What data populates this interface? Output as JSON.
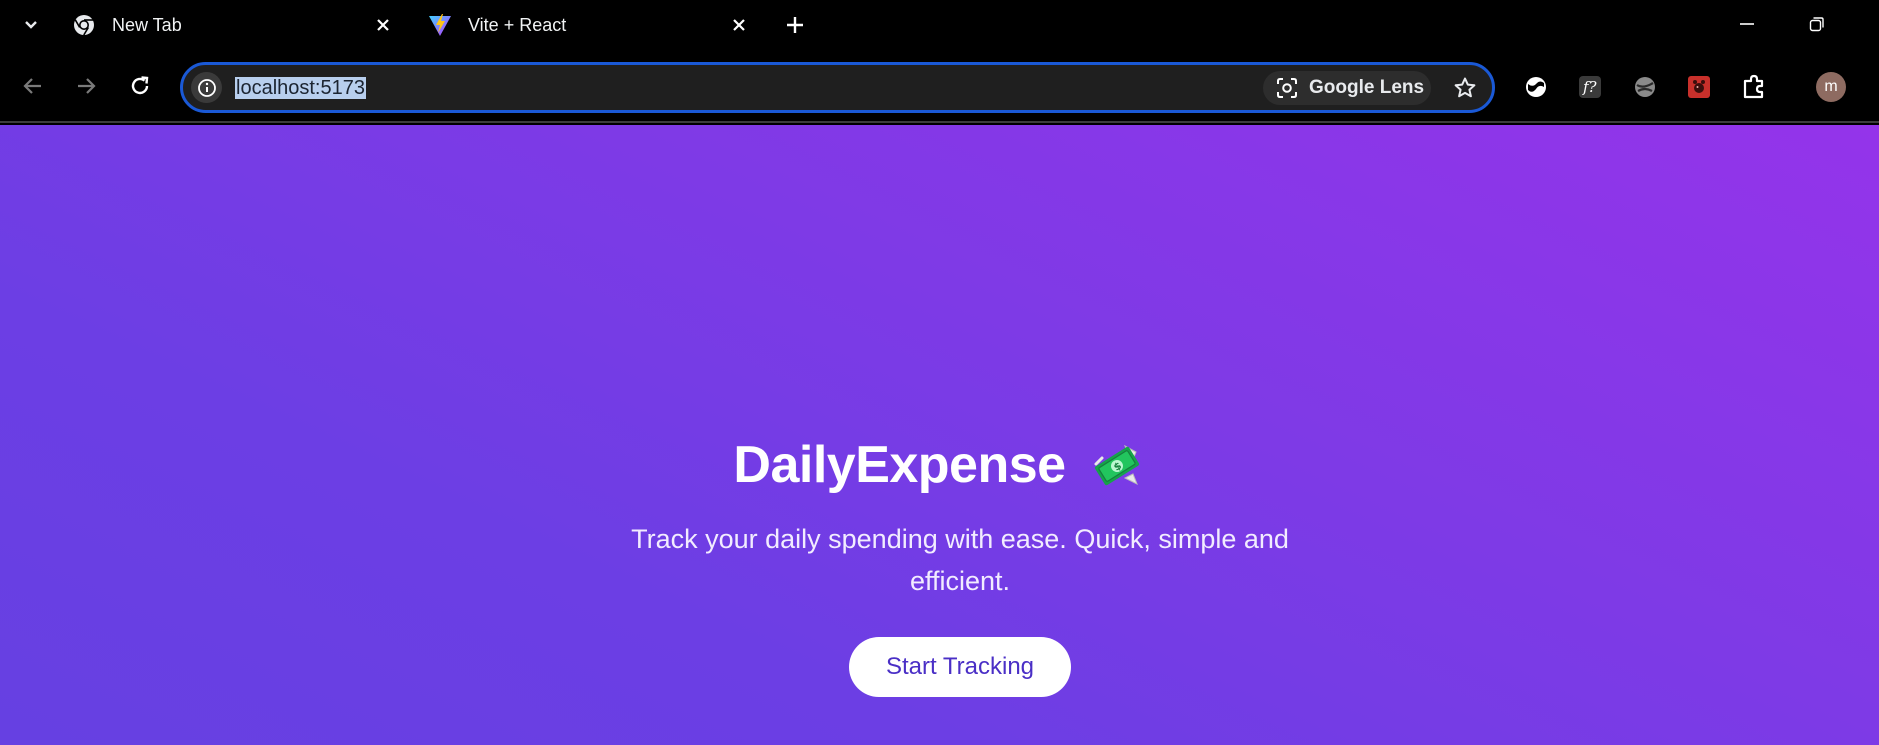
{
  "browser": {
    "tabs": [
      {
        "title": "New Tab",
        "favicon": "chrome-icon",
        "active": false
      },
      {
        "title": "Vite + React",
        "favicon": "vite-icon",
        "active": true
      }
    ],
    "address_bar": {
      "url": "localhost:5173"
    },
    "lens": {
      "label": "Google Lens"
    },
    "avatar": {
      "initial": "m",
      "color": "#8e6b61"
    },
    "extensions": [
      "world-icon",
      "font-identify-icon",
      "globe-icon",
      "red-bug-icon",
      "puzzle-icon"
    ]
  },
  "page": {
    "title": "DailyExpense",
    "title_icon": "flying-money-icon",
    "subtitle": "Track your daily spending with ease. Quick, simple and efficient.",
    "cta_label": "Start Tracking",
    "colors": {
      "gradient_start": "#9434ea",
      "gradient_end": "#6640e2",
      "cta_text": "#4a2fc6",
      "omnibox_border": "#1a59d6"
    }
  }
}
